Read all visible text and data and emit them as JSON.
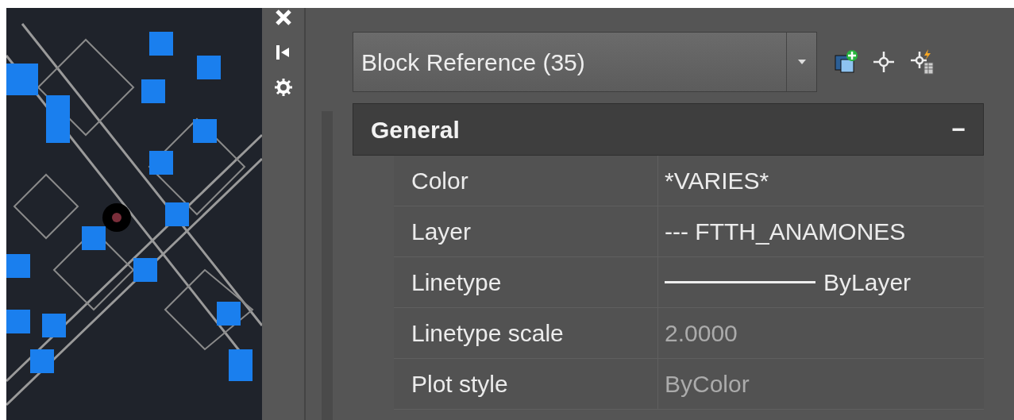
{
  "selection": {
    "value": "Block Reference (35)"
  },
  "section": {
    "title": "General",
    "toggle": "−"
  },
  "properties": [
    {
      "label": "Color",
      "value": "*VARIES*",
      "kind": "text",
      "readonly": false
    },
    {
      "label": "Layer",
      "value": "--- FTTH_ANAMONES",
      "kind": "text",
      "readonly": false
    },
    {
      "label": "Linetype",
      "value": "ByLayer",
      "kind": "linetype",
      "readonly": false
    },
    {
      "label": "Linetype scale",
      "value": "2.0000",
      "kind": "text",
      "readonly": true
    },
    {
      "label": "Plot style",
      "value": "ByColor",
      "kind": "text",
      "readonly": true
    }
  ]
}
